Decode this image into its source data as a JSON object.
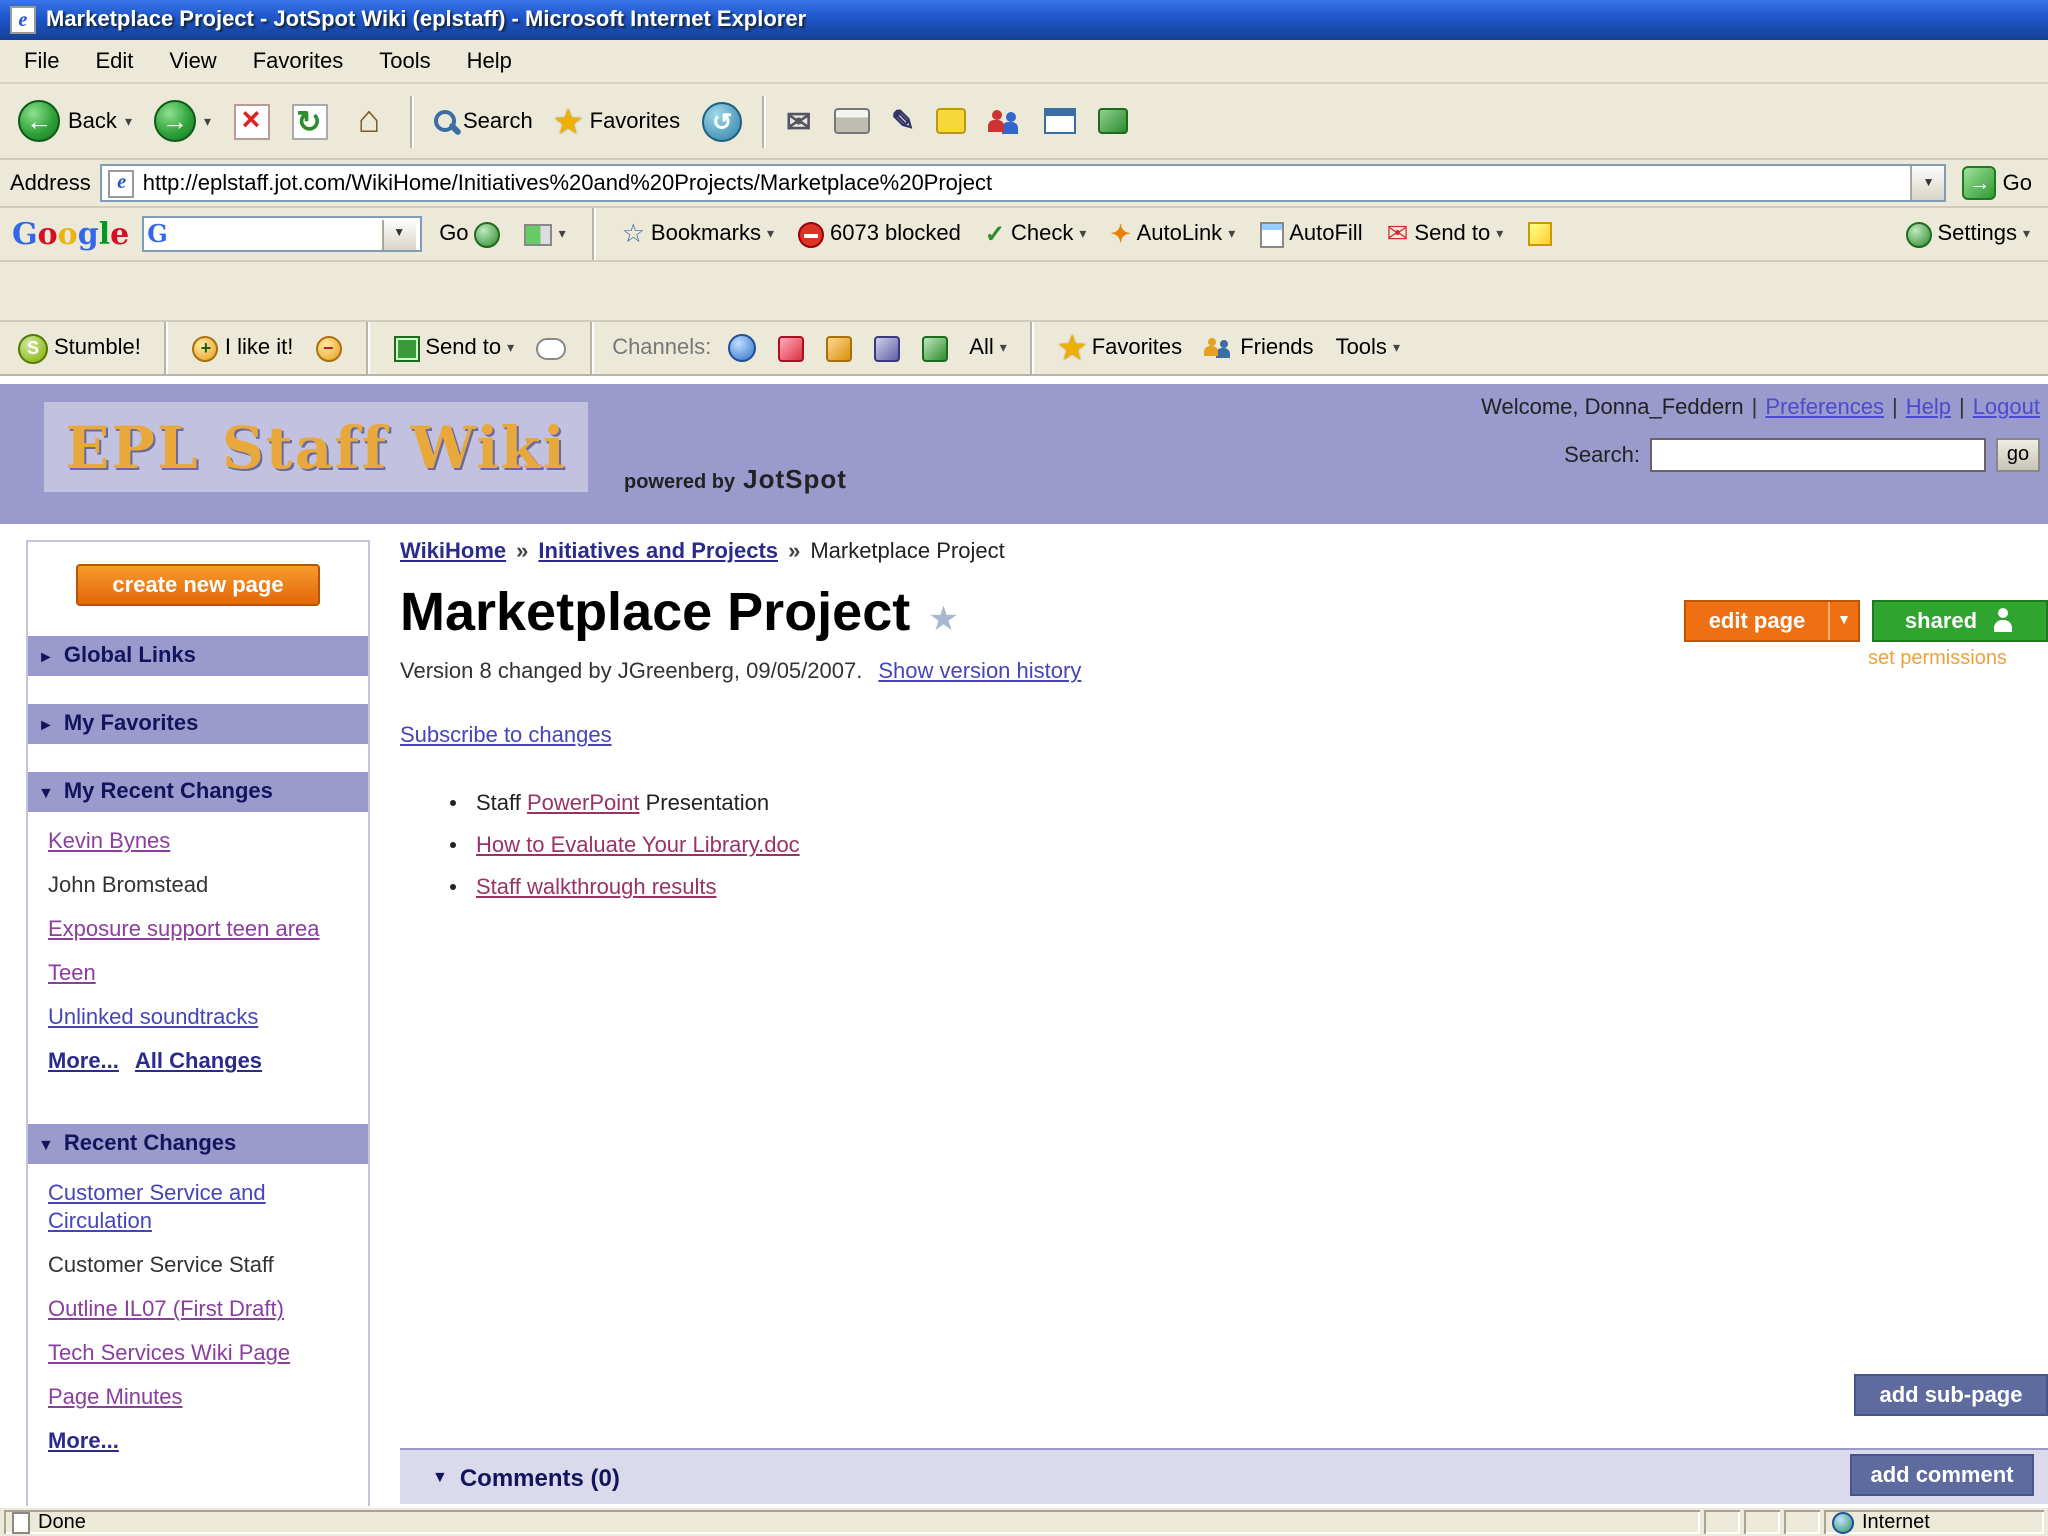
{
  "colors": {
    "header_purple": "#9A9ACC",
    "accent_orange": "#EE7012",
    "accent_green": "#2FA52F",
    "button_slate": "#5E6B9E",
    "logo_gold": "#E8A83C"
  },
  "window": {
    "title": "Marketplace Project - JotSpot Wiki (eplstaff) - Microsoft Internet Explorer"
  },
  "menu": {
    "items": [
      "File",
      "Edit",
      "View",
      "Favorites",
      "Tools",
      "Help"
    ]
  },
  "toolbar": {
    "back": "Back",
    "search": "Search",
    "favorites": "Favorites"
  },
  "address_bar": {
    "label": "Address",
    "url": "http://eplstaff.jot.com/WikiHome/Initiatives%20and%20Projects/Marketplace%20Project",
    "go": "Go"
  },
  "google_toolbar": {
    "logo_letters": [
      "G",
      "o",
      "o",
      "g",
      "l",
      "e"
    ],
    "search_value": "",
    "go": "Go",
    "bookmarks": "Bookmarks",
    "blocked": "6073 blocked",
    "check": "Check",
    "autolink": "AutoLink",
    "autofill": "AutoFill",
    "send_to": "Send to",
    "settings": "Settings"
  },
  "stumble_toolbar": {
    "stumble": "Stumble!",
    "like": "I like it!",
    "send_to": "Send to",
    "channels": "Channels:",
    "all": "All",
    "favorites": "Favorites",
    "friends": "Friends",
    "tools": "Tools"
  },
  "wiki_header": {
    "logo": "EPL Staff Wiki",
    "powered_by": "powered by",
    "brand": "JotSpot",
    "welcome": "Welcome, Donna_Feddern",
    "preferences": "Preferences",
    "help": "Help",
    "logout": "Logout",
    "search_label": "Search:",
    "go": "go"
  },
  "sidebar": {
    "create_button": "create new page",
    "global_links": "Global Links",
    "my_favorites": "My Favorites",
    "my_recent_changes": "My Recent Changes",
    "my_recent_items": [
      "Kevin Bynes",
      "John Bromstead",
      "Exposure support teen area",
      "Teen",
      "Unlinked soundtracks"
    ],
    "my_recent_more": "More...",
    "all_changes": "All Changes",
    "recent_changes": "Recent Changes",
    "recent_items": [
      "Customer Service and Circulation",
      "Customer Service Staff",
      "Outline IL07 (First Draft)",
      "Tech Services Wiki Page",
      "Page Minutes"
    ],
    "recent_more": "More..."
  },
  "content": {
    "breadcrumb": [
      "WikiHome",
      "Initiatives and Projects",
      "Marketplace Project"
    ],
    "title": "Marketplace Project",
    "version_text": "Version 8  changed by JGreenberg, 09/05/2007.",
    "version_link": "Show version history",
    "subscribe": "Subscribe to changes",
    "bullet1_pre": "Staff ",
    "bullet1_link": "PowerPoint",
    "bullet1_post": " Presentation",
    "bullet2": "How to Evaluate Your Library.doc",
    "bullet3": "Staff walkthrough results",
    "edit_page": "edit page",
    "shared": "shared",
    "set_permissions": "set permissions",
    "add_subpage": "add sub-page",
    "comments": "Comments (0)",
    "add_comment": "add comment"
  },
  "status_bar": {
    "left": "Done",
    "right": "Internet"
  }
}
